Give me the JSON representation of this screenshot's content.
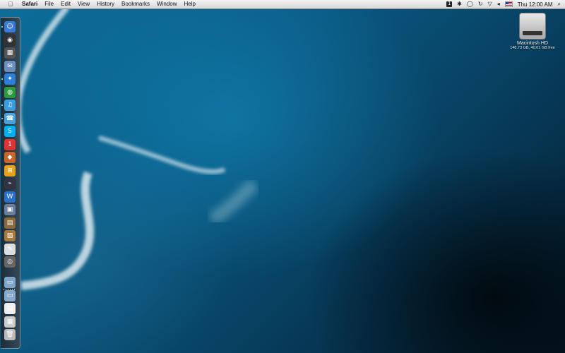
{
  "menubar": {
    "apple_icon": "apple-icon",
    "app_name": "Safari",
    "menus": [
      "File",
      "Edit",
      "View",
      "History",
      "Bookmarks",
      "Window",
      "Help"
    ],
    "status": {
      "badge": "1",
      "clock": "Thu 12:00 AM"
    }
  },
  "desktop": {
    "drive": {
      "name": "Macintosh HD",
      "info": "148.73 GB, 40.01 GB free"
    }
  },
  "dock": {
    "apps": [
      {
        "name": "finder-icon",
        "glyph": "☺",
        "color": "#3a7bd5"
      },
      {
        "name": "dashboard-icon",
        "glyph": "◉",
        "color": "#333"
      },
      {
        "name": "spaces-icon",
        "glyph": "▦",
        "color": "#555"
      },
      {
        "name": "mail-icon",
        "glyph": "✉",
        "color": "#6a8fbf"
      },
      {
        "name": "safari-icon",
        "glyph": "✦",
        "color": "#2d7fd8"
      },
      {
        "name": "globe-icon",
        "glyph": "◍",
        "color": "#2a9a3a"
      },
      {
        "name": "itunes-icon",
        "glyph": "♫",
        "color": "#3b9de0"
      },
      {
        "name": "ichat-icon",
        "glyph": "☎",
        "color": "#4aa3df"
      },
      {
        "name": "skype-icon",
        "glyph": "S",
        "color": "#00aff0"
      },
      {
        "name": "ical-icon",
        "glyph": "1",
        "color": "#d33"
      },
      {
        "name": "photo-icon",
        "glyph": "◆",
        "color": "#c7652a"
      },
      {
        "name": "windows-icon",
        "glyph": "⊞",
        "color": "#e9a21e"
      },
      {
        "name": "network-icon",
        "glyph": "⌁",
        "color": "#334"
      },
      {
        "name": "wunderlist-icon",
        "glyph": "W",
        "color": "#2a6fc9"
      },
      {
        "name": "preview-icon",
        "glyph": "▣",
        "color": "#6a7f99"
      },
      {
        "name": "iphoto-icon",
        "glyph": "▤",
        "color": "#8a6a3a"
      },
      {
        "name": "image-icon",
        "glyph": "▧",
        "color": "#a57a3e"
      },
      {
        "name": "textedit-icon",
        "glyph": "✎",
        "color": "#ddd"
      },
      {
        "name": "app-store-icon",
        "glyph": "◎",
        "color": "#666"
      }
    ],
    "stacks": [
      {
        "name": "applications-folder-icon",
        "glyph": "▭",
        "color": "#7fa6c8"
      },
      {
        "name": "documents-folder-icon",
        "glyph": "▭",
        "color": "#86aacb"
      },
      {
        "name": "document-icon",
        "glyph": "▤",
        "color": "#eee"
      },
      {
        "name": "downloads-icon",
        "glyph": "▦",
        "color": "#ccc"
      },
      {
        "name": "trash-icon",
        "glyph": "🗑",
        "color": "#bbb"
      }
    ]
  }
}
